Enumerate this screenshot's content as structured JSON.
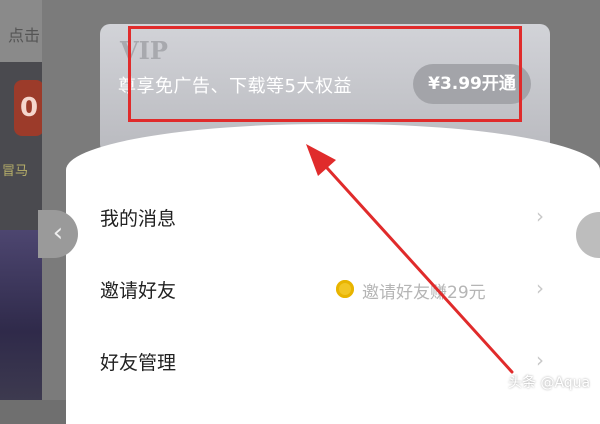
{
  "background_app": {
    "tap_text": "点击",
    "logo_text": "0",
    "logo_label": "冒马"
  },
  "vip": {
    "mark": "VIP",
    "description": "尊享免广告、下载等5大权益",
    "button_label": "¥3.99开通"
  },
  "menu": {
    "items": [
      {
        "label": "我的消息",
        "hint": ""
      },
      {
        "label": "邀请好友",
        "hint": "邀请好友赚29元"
      },
      {
        "label": "好友管理",
        "hint": ""
      }
    ]
  },
  "nav": {
    "left_icon": "‹"
  },
  "watermark": "头条 @Aqua",
  "colors": {
    "annotation": "#e02b2b",
    "coin": "#f2c623"
  }
}
